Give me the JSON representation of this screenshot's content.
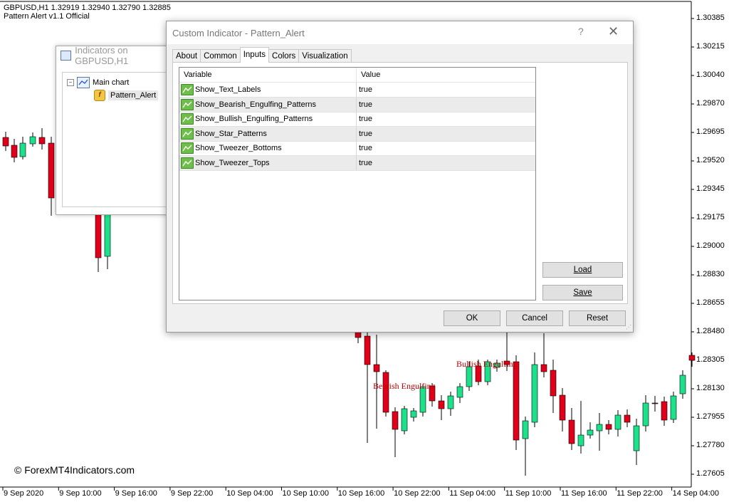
{
  "chart": {
    "header": {
      "symbol_line": "GBPUSD,H1  1.32919 1.32940 1.32790 1.32885",
      "indicator_line": "Pattern Alert v1.1 Official"
    },
    "price_axis": [
      "1.30385",
      "1.30215",
      "1.30040",
      "1.29870",
      "1.29695",
      "1.29520",
      "1.29345",
      "1.29175",
      "1.29000",
      "1.28830",
      "1.28655",
      "1.28480",
      "1.28305",
      "1.28130",
      "1.27955",
      "1.27780",
      "1.27605"
    ],
    "time_axis": [
      "9 Sep 2020",
      "9 Sep 10:00",
      "9 Sep 16:00",
      "9 Sep 22:00",
      "10 Sep 04:00",
      "10 Sep 10:00",
      "10 Sep 16:00",
      "10 Sep 22:00",
      "11 Sep 04:00",
      "11 Sep 10:00",
      "11 Sep 16:00",
      "11 Sep 22:00",
      "14 Sep 04:00"
    ],
    "pattern_labels": [
      "Bearish Engulfing",
      "Bullish Engulfing"
    ],
    "watermark": "© ForexMT4Indicators.com",
    "colors": {
      "bull": "#1de08a",
      "bear": "#e0001a",
      "wick": "#000000"
    }
  },
  "indicators_window": {
    "title": "Indicators on GBPUSD,H1",
    "tree": {
      "root": "Main chart",
      "child": "Pattern_Alert"
    }
  },
  "dialog": {
    "title": "Custom Indicator - Pattern_Alert",
    "help": "?",
    "close": "✕",
    "tabs": [
      "About",
      "Common",
      "Inputs",
      "Colors",
      "Visualization"
    ],
    "active_tab": "Inputs",
    "grid": {
      "headers": [
        "Variable",
        "Value"
      ],
      "rows": [
        {
          "variable": "Show_Text_Labels",
          "value": "true"
        },
        {
          "variable": "Show_Bearish_Engulfing_Patterns",
          "value": "true"
        },
        {
          "variable": "Show_Bullish_Engulfing_Patterns",
          "value": "true"
        },
        {
          "variable": "Show_Star_Patterns",
          "value": "true"
        },
        {
          "variable": "Show_Tweezer_Bottoms",
          "value": "true"
        },
        {
          "variable": "Show_Tweezer_Tops",
          "value": "true"
        }
      ]
    },
    "buttons": {
      "load": "Load",
      "save": "Save",
      "ok": "OK",
      "cancel": "Cancel",
      "reset": "Reset"
    }
  }
}
